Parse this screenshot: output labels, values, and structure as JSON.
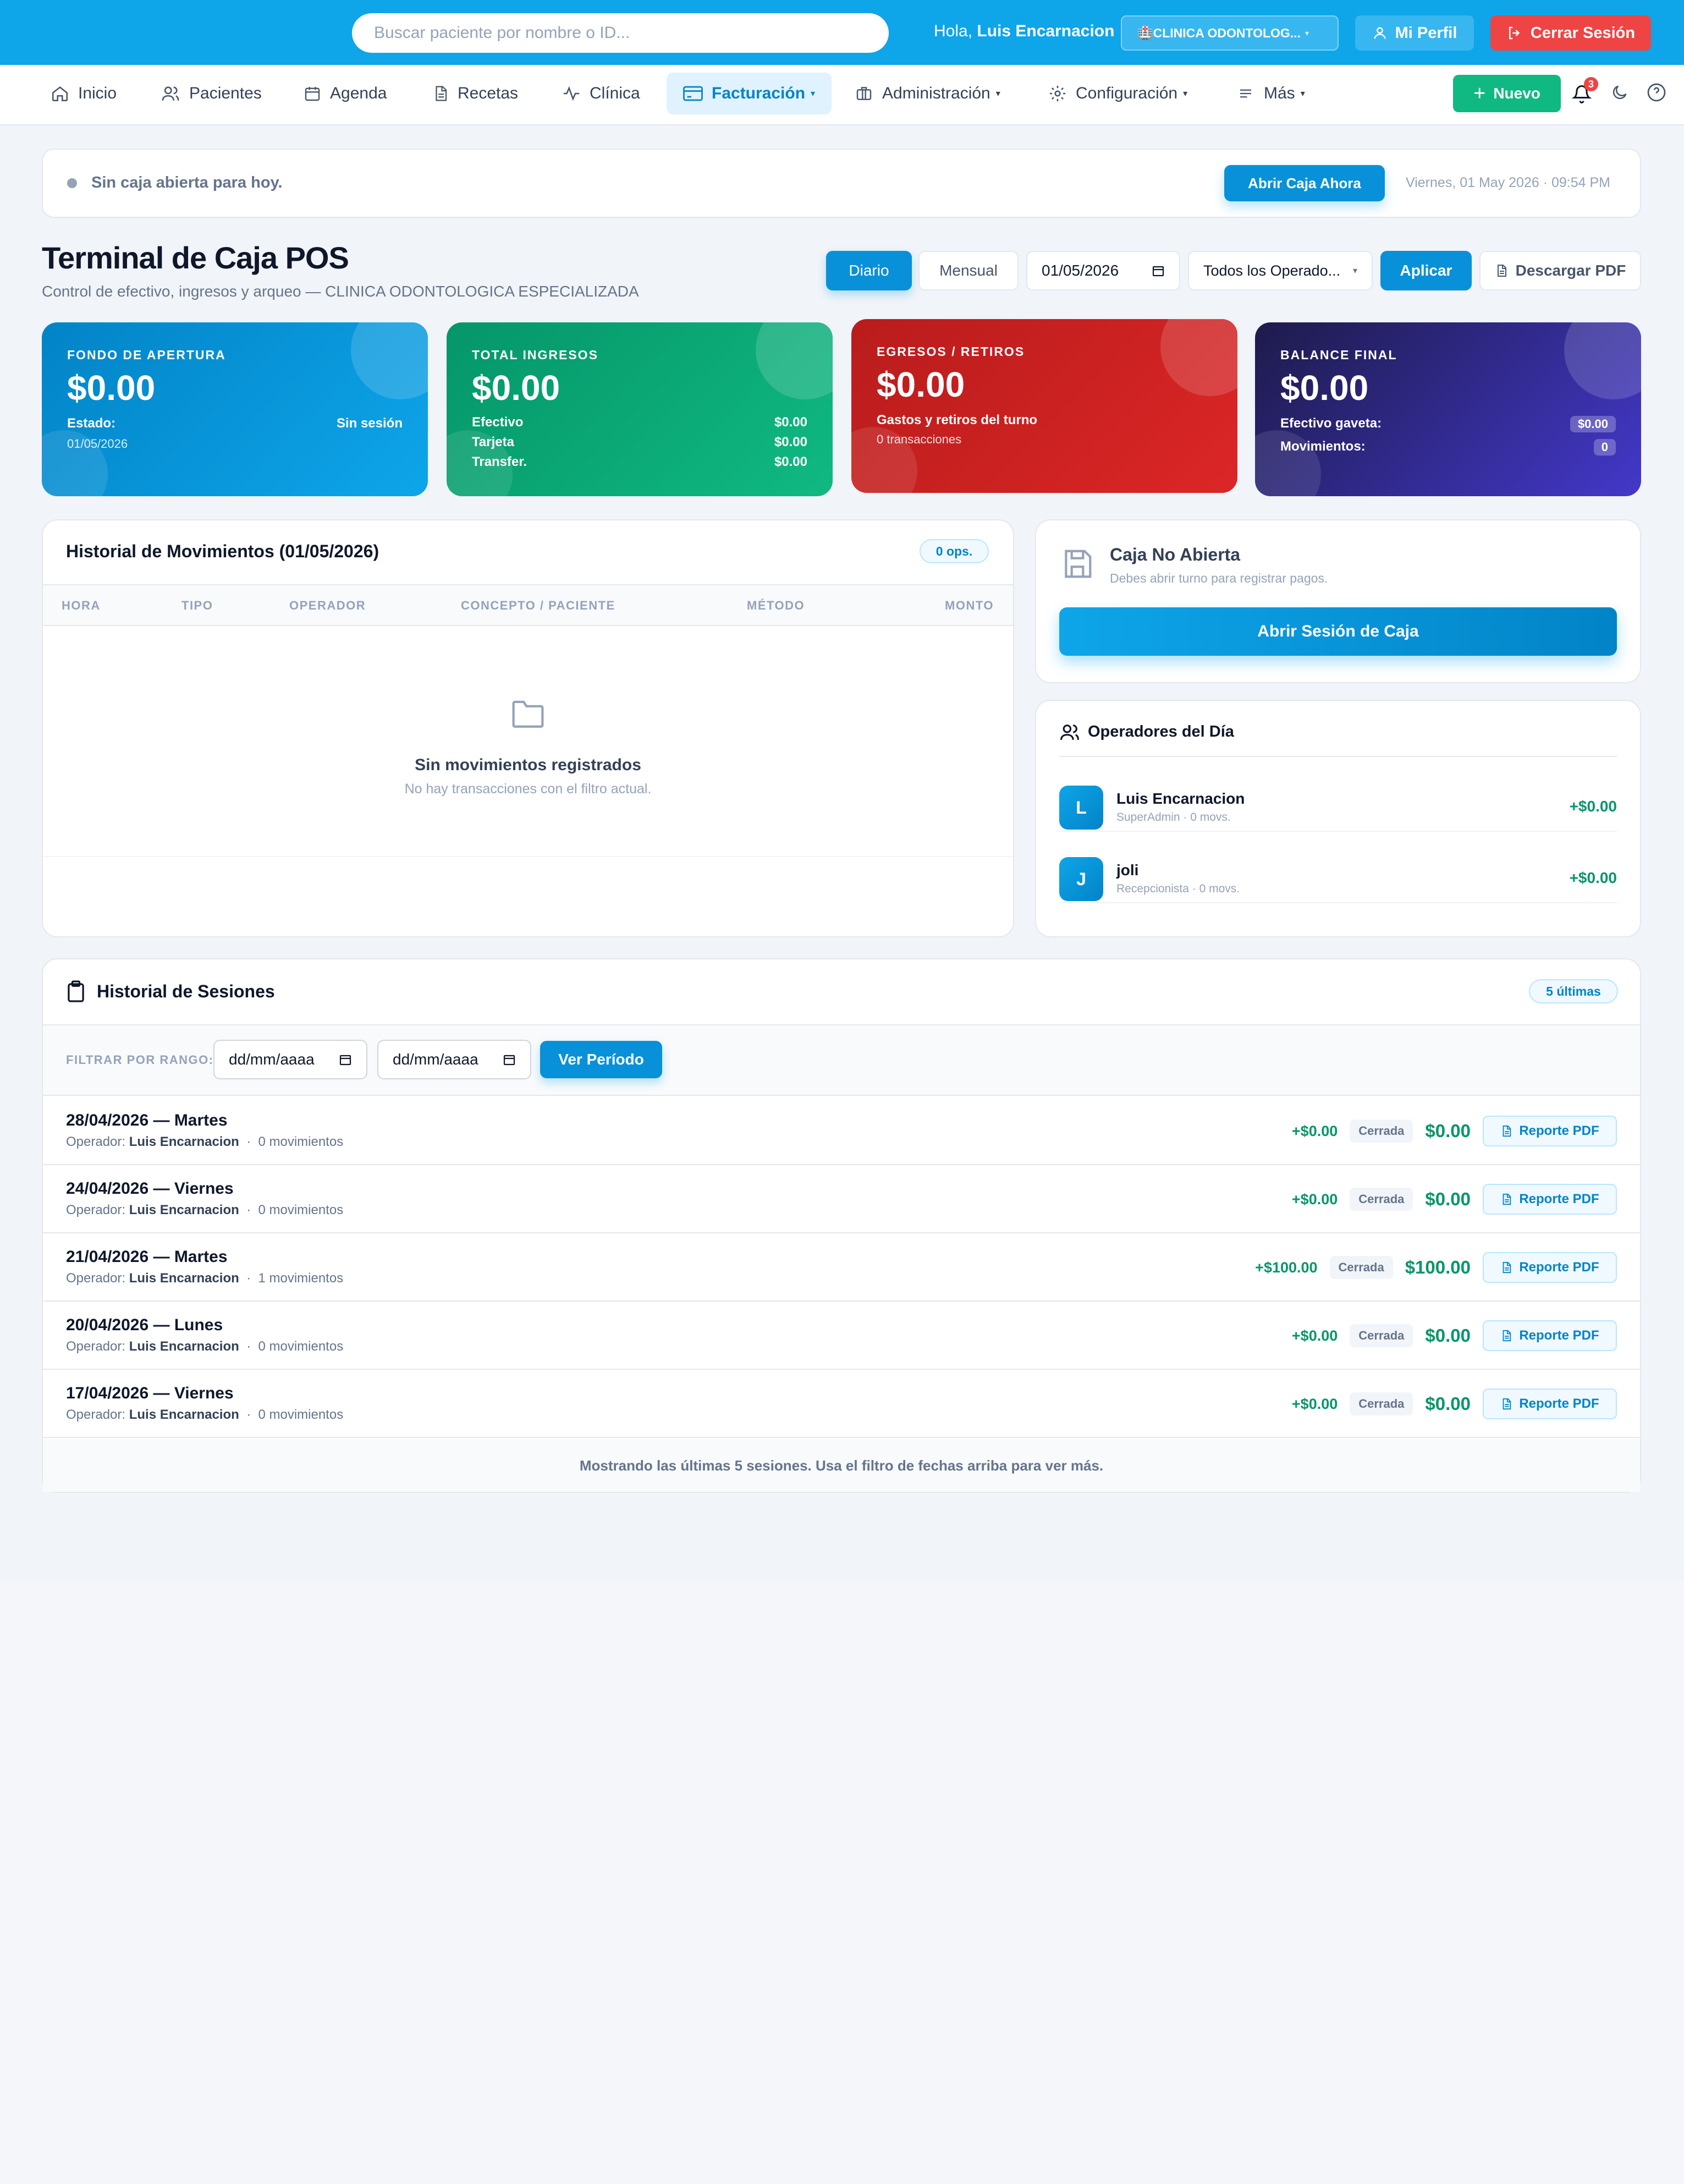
{
  "header": {
    "search_placeholder": "Buscar paciente por nombre o ID...",
    "greeting_prefix": "Hola,",
    "user_name": "Luis Encarnacion",
    "clinic_label": "🏥CLINICA ODONTOLOG...",
    "profile_label": "Mi Perfil",
    "logout_label": "Cerrar Sesión"
  },
  "nav": {
    "items": [
      {
        "label": "Inicio",
        "icon": "home-icon"
      },
      {
        "label": "Pacientes",
        "icon": "users-icon"
      },
      {
        "label": "Agenda",
        "icon": "calendar-icon"
      },
      {
        "label": "Recetas",
        "icon": "document-icon"
      },
      {
        "label": "Clínica",
        "icon": "activity-icon"
      },
      {
        "label": "Facturación",
        "icon": "credit-card-icon",
        "active": true
      },
      {
        "label": "Administración",
        "icon": "briefcase-icon"
      },
      {
        "label": "Configuración",
        "icon": "gear-icon"
      },
      {
        "label": "Más",
        "icon": "menu-icon"
      }
    ],
    "new_label": "Nuevo",
    "notification_count": "3"
  },
  "alert": {
    "text": "Sin caja abierta para hoy.",
    "button": "Abrir Caja Ahora",
    "datetime": "Viernes, 01 May 2026 · 09:54 PM"
  },
  "page": {
    "title": "Terminal de Caja POS",
    "subtitle": "Control de efectivo, ingresos y arqueo — CLINICA ODONTOLOGICA ESPECIALIZADA"
  },
  "toolbar": {
    "daily": "Diario",
    "monthly": "Mensual",
    "date": "01/05/2026",
    "operator": "Todos los Operado...",
    "apply": "Aplicar",
    "pdf": "Descargar PDF"
  },
  "cards": {
    "fondo": {
      "label": "FONDO DE APERTURA",
      "value": "$0.00",
      "status_label": "Estado:",
      "status_value": "Sin sesión",
      "date": "01/05/2026"
    },
    "ingresos": {
      "label": "TOTAL INGRESOS",
      "value": "$0.00",
      "rows": [
        {
          "label": "Efectivo",
          "value": "$0.00"
        },
        {
          "label": "Tarjeta",
          "value": "$0.00"
        },
        {
          "label": "Transfer.",
          "value": "$0.00"
        }
      ]
    },
    "egresos": {
      "label": "EGRESOS / RETIROS",
      "value": "$0.00",
      "sub": "Gastos y retiros del turno",
      "count": "0 transacciones"
    },
    "balance": {
      "label": "BALANCE FINAL",
      "value": "$0.00",
      "cash_label": "Efectivo gaveta:",
      "cash_value": "$0.00",
      "moves_label": "Movimientos:",
      "moves_value": "0"
    }
  },
  "movements": {
    "title": "Historial de Movimientos (01/05/2026)",
    "badge": "0 ops.",
    "columns": [
      "HORA",
      "TIPO",
      "OPERADOR",
      "CONCEPTO / PACIENTE",
      "MÉTODO",
      "MONTO"
    ],
    "empty_title": "Sin movimientos registrados",
    "empty_sub": "No hay transacciones con el filtro actual."
  },
  "caja": {
    "title": "Caja No Abierta",
    "sub": "Debes abrir turno para registrar pagos.",
    "button": "Abrir Sesión de Caja"
  },
  "operators": {
    "title": "Operadores del Día",
    "list": [
      {
        "initial": "L",
        "name": "Luis Encarnacion",
        "role": "SuperAdmin · 0 movs.",
        "amount": "+$0.00"
      },
      {
        "initial": "J",
        "name": "joli",
        "role": "Recepcionista · 0 movs.",
        "amount": "+$0.00"
      }
    ]
  },
  "sessions": {
    "title": "Historial de Sesiones",
    "badge": "5 últimas",
    "filter_label": "FILTRAR POR RANGO:",
    "from_placeholder": "dd/mm/aaaa",
    "to_placeholder": "dd/mm/aaaa",
    "view_button": "Ver Período",
    "operator_prefix": "Operador:",
    "rows": [
      {
        "date": "28/04/2026 — Martes",
        "operator": "Luis Encarnacion",
        "moves": "0 movimientos",
        "income": "+$0.00",
        "status": "Cerrada",
        "total": "$0.00",
        "pdf": "Reporte PDF"
      },
      {
        "date": "24/04/2026 — Viernes",
        "operator": "Luis Encarnacion",
        "moves": "0 movimientos",
        "income": "+$0.00",
        "status": "Cerrada",
        "total": "$0.00",
        "pdf": "Reporte PDF"
      },
      {
        "date": "21/04/2026 — Martes",
        "operator": "Luis Encarnacion",
        "moves": "1 movimientos",
        "income": "+$100.00",
        "status": "Cerrada",
        "total": "$100.00",
        "pdf": "Reporte PDF"
      },
      {
        "date": "20/04/2026 — Lunes",
        "operator": "Luis Encarnacion",
        "moves": "0 movimientos",
        "income": "+$0.00",
        "status": "Cerrada",
        "total": "$0.00",
        "pdf": "Reporte PDF"
      },
      {
        "date": "17/04/2026 — Viernes",
        "operator": "Luis Encarnacion",
        "moves": "0 movimientos",
        "income": "+$0.00",
        "status": "Cerrada",
        "total": "$0.00",
        "pdf": "Reporte PDF"
      }
    ],
    "footer": "Mostrando las últimas 5 sesiones. Usa el filtro de fechas arriba para ver más."
  },
  "colors": {
    "primary": "#0ea5e9",
    "success": "#10b981",
    "danger": "#ef4444",
    "indigo": "#4338ca"
  }
}
